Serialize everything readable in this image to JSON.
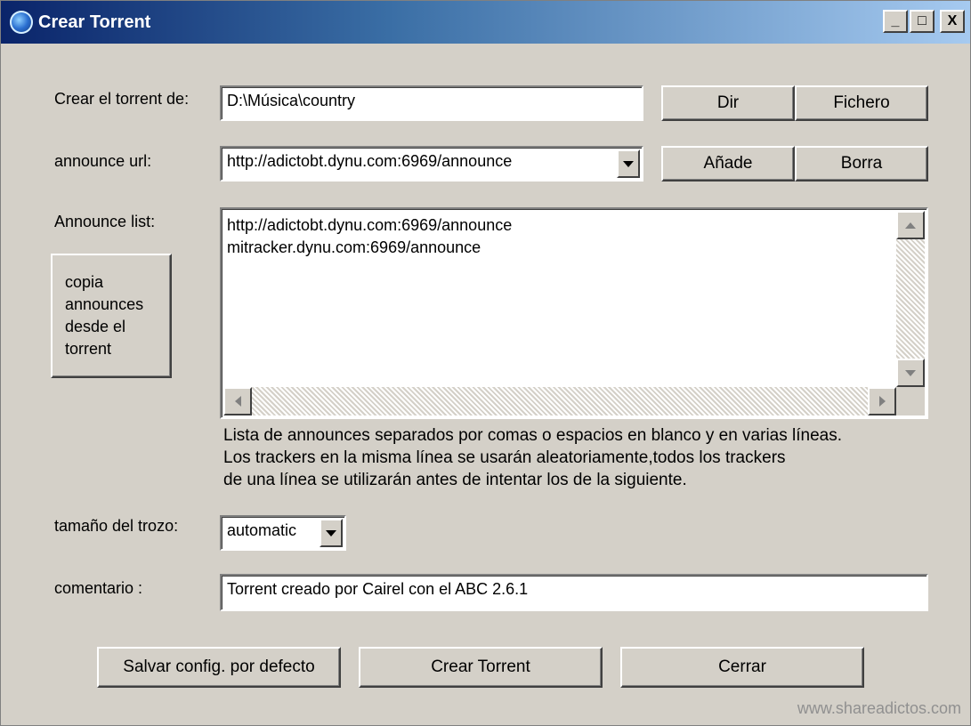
{
  "window": {
    "title": "Crear Torrent"
  },
  "titlebar_buttons": {
    "minimize": "_",
    "maximize": "□",
    "close": "X"
  },
  "source": {
    "label": "Crear el torrent de:",
    "value": "D:\\Música\\country",
    "dir_button": "Dir",
    "file_button": "Fichero"
  },
  "announce": {
    "label": "announce url:",
    "value": "http://adictobt.dynu.com:6969/announce",
    "add_button": "Añade",
    "remove_button": "Borra"
  },
  "announce_list": {
    "label": "Announce list:",
    "lines": [
      "http://adictobt.dynu.com:6969/announce",
      "mitracker.dynu.com:6969/announce"
    ],
    "copy_button": [
      "copia",
      "announces",
      "desde el",
      "torrent"
    ],
    "help": [
      "Lista de announces separados por comas o espacios en blanco y en varias líneas.",
      "Los trackers en la misma línea se usarán aleatoriamente,todos los trackers",
      "de una línea se utilizarán antes de intentar los de la siguiente."
    ]
  },
  "piece_size": {
    "label": "tamaño del trozo:",
    "value": "automatic"
  },
  "comment": {
    "label": "comentario :",
    "value": "Torrent creado por Cairel con el ABC 2.6.1"
  },
  "actions": {
    "save_defaults": "Salvar config. por defecto",
    "create": "Crear Torrent",
    "close": "Cerrar"
  },
  "watermark": "www.shareadictos.com"
}
